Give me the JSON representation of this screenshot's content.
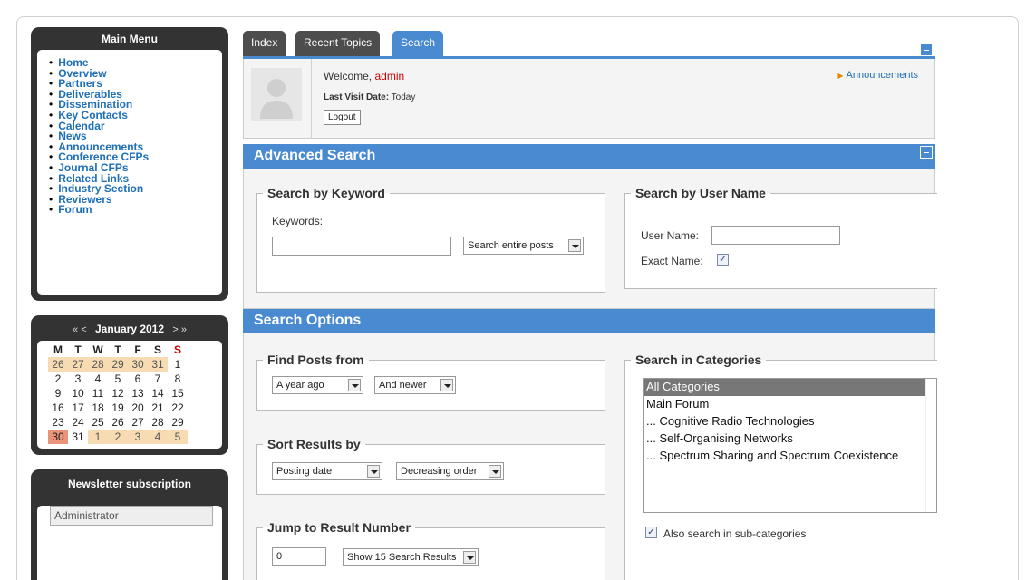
{
  "menu": {
    "title": "Main Menu",
    "items": [
      {
        "label": "Home"
      },
      {
        "label": "Overview"
      },
      {
        "label": "Partners"
      },
      {
        "label": "Deliverables"
      },
      {
        "label": "Dissemination"
      },
      {
        "label": "Key Contacts"
      },
      {
        "label": "Calendar"
      },
      {
        "label": "News"
      },
      {
        "label": "Announcements"
      },
      {
        "label": "Conference CFPs"
      },
      {
        "label": "Journal CFPs"
      },
      {
        "label": "Related Links"
      },
      {
        "label": "Industry Section"
      },
      {
        "label": "Reviewers"
      },
      {
        "label": "Forum"
      }
    ]
  },
  "calendar": {
    "prev": "« <",
    "next": "> »",
    "month": "January 2012",
    "weekdays": [
      "M",
      "T",
      "W",
      "T",
      "F",
      "S",
      "S"
    ],
    "weeks": [
      [
        {
          "d": "26",
          "o": 1
        },
        {
          "d": "27",
          "o": 1
        },
        {
          "d": "28",
          "o": 1
        },
        {
          "d": "29",
          "o": 1
        },
        {
          "d": "30",
          "o": 1
        },
        {
          "d": "31",
          "o": 1
        },
        {
          "d": "1"
        }
      ],
      [
        {
          "d": "2"
        },
        {
          "d": "3"
        },
        {
          "d": "4"
        },
        {
          "d": "5"
        },
        {
          "d": "6"
        },
        {
          "d": "7"
        },
        {
          "d": "8"
        }
      ],
      [
        {
          "d": "9"
        },
        {
          "d": "10"
        },
        {
          "d": "11"
        },
        {
          "d": "12"
        },
        {
          "d": "13"
        },
        {
          "d": "14"
        },
        {
          "d": "15"
        }
      ],
      [
        {
          "d": "16"
        },
        {
          "d": "17"
        },
        {
          "d": "18"
        },
        {
          "d": "19"
        },
        {
          "d": "20"
        },
        {
          "d": "21"
        },
        {
          "d": "22"
        }
      ],
      [
        {
          "d": "23"
        },
        {
          "d": "24"
        },
        {
          "d": "25"
        },
        {
          "d": "26"
        },
        {
          "d": "27"
        },
        {
          "d": "28"
        },
        {
          "d": "29"
        }
      ],
      [
        {
          "d": "30",
          "t": 1
        },
        {
          "d": "31"
        },
        {
          "d": "1",
          "o": 1
        },
        {
          "d": "2",
          "o": 1
        },
        {
          "d": "3",
          "o": 1
        },
        {
          "d": "4",
          "o": 1
        },
        {
          "d": "5",
          "o": 1
        }
      ]
    ]
  },
  "newsletter": {
    "title": "Newsletter subscription",
    "name_value": "Administrator"
  },
  "tabs": {
    "index": "Index",
    "recent": "Recent Topics",
    "search": "Search"
  },
  "welcome": {
    "greeting": "Welcome,",
    "user": "admin",
    "last_visit_label": "Last Visit Date:",
    "last_visit_value": "Today",
    "logout": "Logout",
    "announcements": "Announcements"
  },
  "advanced": {
    "title": "Advanced Search",
    "keyword_legend": "Search by Keyword",
    "keywords_label": "Keywords:",
    "keywords_value": "",
    "scope_select": "Search entire posts",
    "user_legend": "Search by User Name",
    "user_label": "User Name:",
    "user_value": "",
    "exact_label": "Exact Name:",
    "exact_checked": true
  },
  "options": {
    "title": "Search Options",
    "find_legend": "Find Posts from",
    "time_select": "A year ago",
    "direction_select": "And newer",
    "sort_legend": "Sort Results by",
    "sort_select": "Posting date",
    "order_select": "Decreasing order",
    "jump_legend": "Jump to Result Number",
    "jump_value": "0",
    "results_select": "Show 15 Search Results",
    "categories_legend": "Search in Categories",
    "categories": [
      "All Categories",
      "Main Forum",
      "... Cognitive Radio Technologies",
      "... Self-Organising Networks",
      "... Spectrum Sharing and Spectrum Coexistence"
    ],
    "selected_category_index": 0,
    "subcat_label": "Also search in sub-categories",
    "subcat_checked": true
  },
  "icons": {
    "checkmark": "✓",
    "bullet": "•",
    "triangle": "▶"
  },
  "colors": {
    "accent": "#4a8ad0",
    "dark_panel": "#333333",
    "link": "#1d6fb8",
    "username": "#cc0000"
  }
}
